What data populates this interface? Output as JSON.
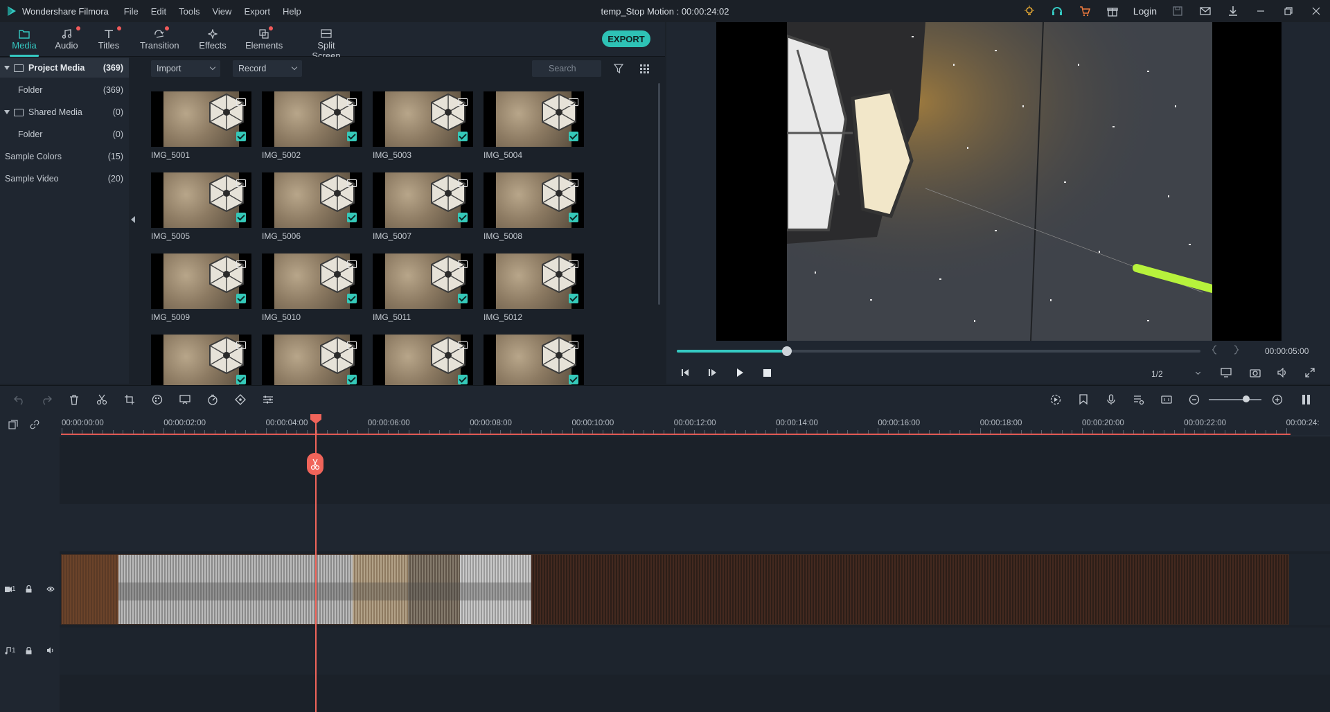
{
  "app": {
    "name": "Wondershare Filmora",
    "window_title": "temp_Stop Motion : 00:00:24:02",
    "login": "Login"
  },
  "menu": [
    "File",
    "Edit",
    "Tools",
    "View",
    "Export",
    "Help"
  ],
  "tabs": [
    {
      "label": "Media",
      "icon": "folder-icon",
      "active": true,
      "dot": false
    },
    {
      "label": "Audio",
      "icon": "music-note-icon",
      "active": false,
      "dot": true
    },
    {
      "label": "Titles",
      "icon": "text-icon",
      "active": false,
      "dot": true
    },
    {
      "label": "Transition",
      "icon": "transition-icon",
      "active": false,
      "dot": true
    },
    {
      "label": "Effects",
      "icon": "effects-icon",
      "active": false,
      "dot": false
    },
    {
      "label": "Elements",
      "icon": "elements-icon",
      "active": false,
      "dot": true
    },
    {
      "label": "Split Screen",
      "icon": "split-screen-icon",
      "active": false,
      "dot": false
    }
  ],
  "export_label": "EXPORT",
  "sidebar": {
    "items": [
      {
        "label": "Project Media",
        "count": "(369)"
      },
      {
        "label": "Folder",
        "count": "(369)"
      },
      {
        "label": "Shared Media",
        "count": "(0)"
      },
      {
        "label": "Folder",
        "count": "(0)"
      },
      {
        "label": "Sample Colors",
        "count": "(15)"
      },
      {
        "label": "Sample Video",
        "count": "(20)"
      }
    ]
  },
  "media_toolbar": {
    "import_label": "Import",
    "record_label": "Record",
    "search_placeholder": "Search"
  },
  "media_items": [
    "IMG_5001",
    "IMG_5002",
    "IMG_5003",
    "IMG_5004",
    "IMG_5005",
    "IMG_5006",
    "IMG_5007",
    "IMG_5008",
    "IMG_5009",
    "IMG_5010",
    "IMG_5011",
    "IMG_5012",
    "",
    "",
    "",
    ""
  ],
  "preview": {
    "timecode": "00:00:05:00",
    "progress_fraction": 0.21,
    "ratio": "1/2"
  },
  "timeline": {
    "ruler_labels": [
      "00:00:00:00",
      "00:00:02:00",
      "00:00:04:00",
      "00:00:06:00",
      "00:00:08:00",
      "00:00:10:00",
      "00:00:12:00",
      "00:00:14:00",
      "00:00:16:00",
      "00:00:18:00",
      "00:00:20:00",
      "00:00:22:00",
      "00:00:24:"
    ],
    "video_track_label": "1",
    "audio_track_label": "1"
  },
  "colors": {
    "accent": "#35c9c2",
    "playhead": "#f0645a",
    "notification_dot": "#f25a5a"
  }
}
